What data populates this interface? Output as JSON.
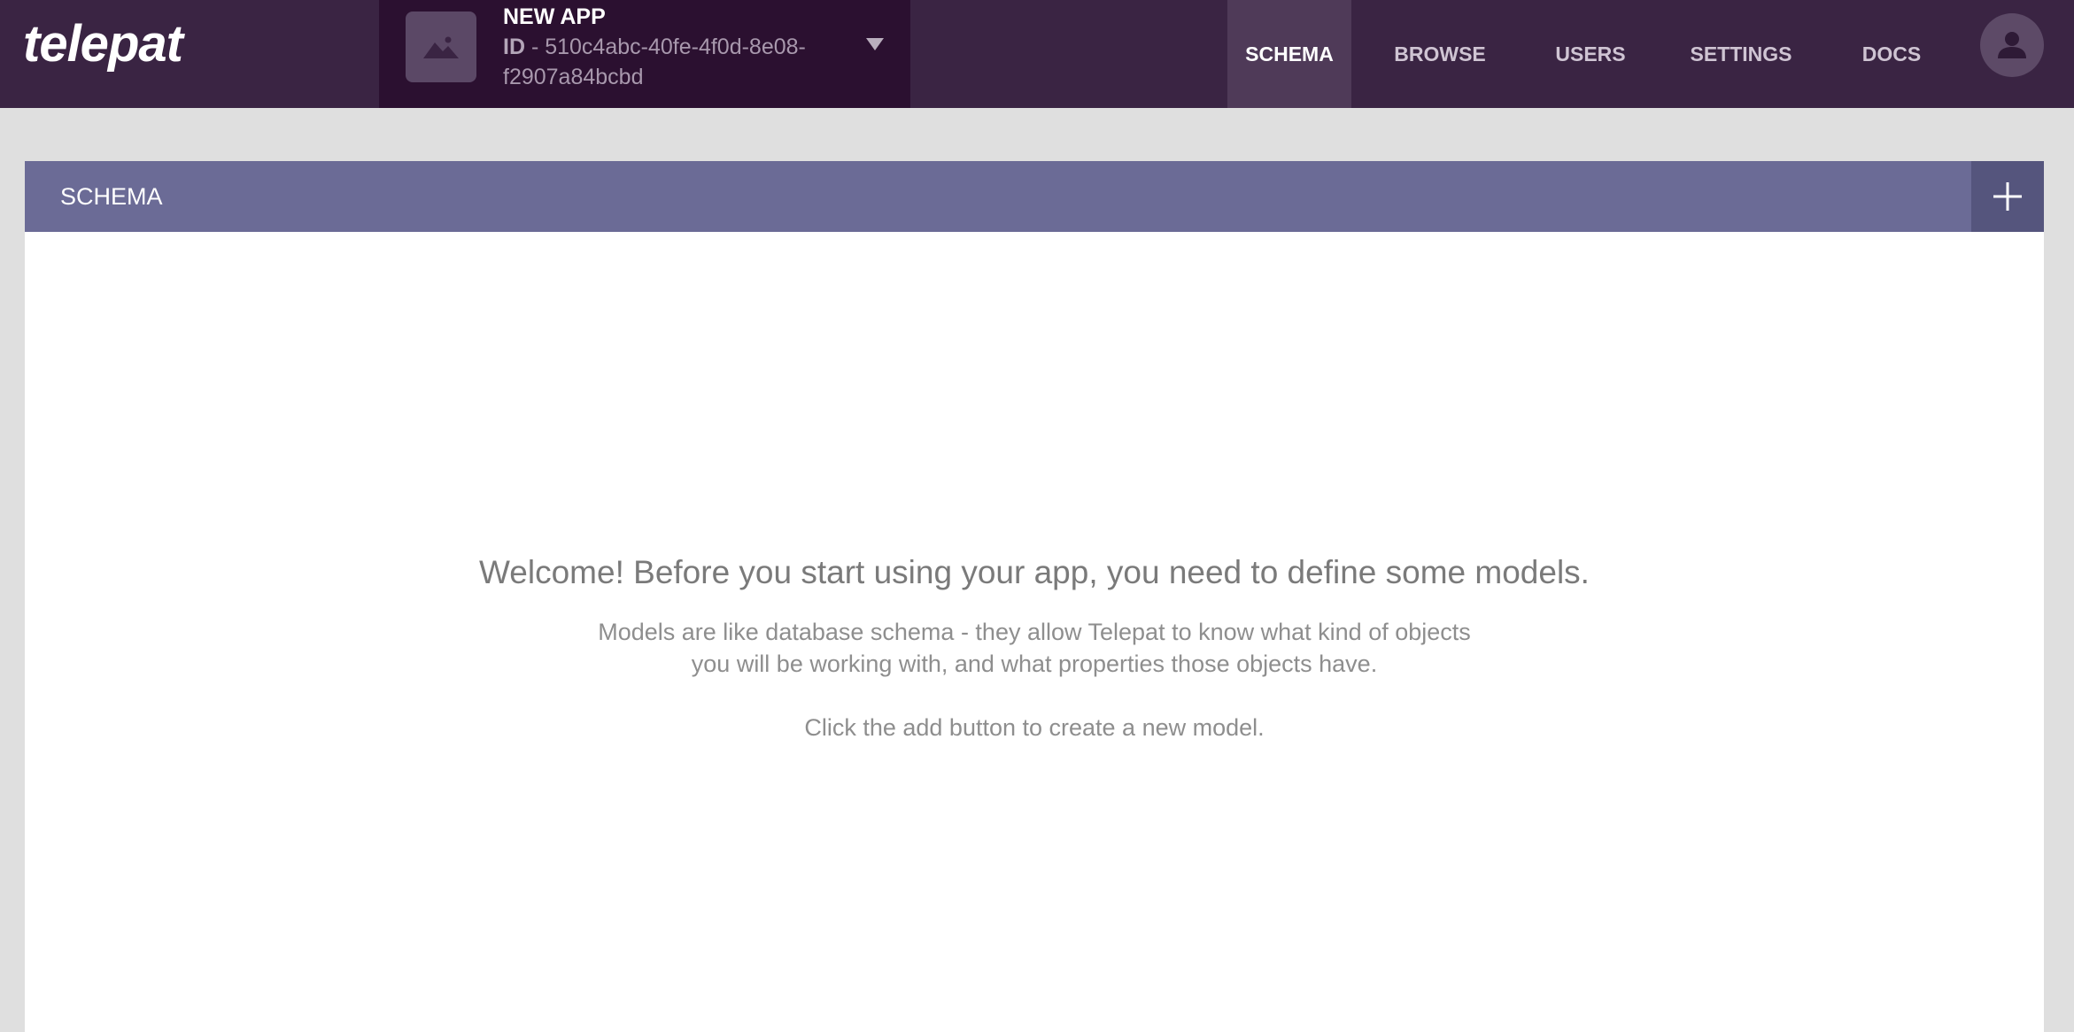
{
  "brand": {
    "logo_text": "telepat"
  },
  "app": {
    "name": "NEW APP",
    "id_label": "ID",
    "id_separator": " - ",
    "id_value": "510c4abc-40fe-4f0d-8e08-f2907a84bcbd",
    "thumbnail_icon": "image-icon",
    "dropdown_icon": "caret-down-icon"
  },
  "nav": {
    "items": [
      {
        "label": "SCHEMA",
        "active": true
      },
      {
        "label": "BROWSE",
        "active": false
      },
      {
        "label": "USERS",
        "active": false
      },
      {
        "label": "SETTINGS",
        "active": false
      },
      {
        "label": "DOCS",
        "active": false
      }
    ],
    "avatar_icon": "user-icon"
  },
  "schema": {
    "title": "SCHEMA",
    "add_icon": "plus-icon",
    "empty": {
      "heading": "Welcome! Before you start using your app, you need to define some models.",
      "description_line1": "Models are like database schema - they allow Telepat to know what kind of objects",
      "description_line2": "you will be working with, and what properties those objects have.",
      "hint": "Click the add button to create a new model."
    }
  },
  "colors": {
    "topbar": "#3a2443",
    "app_switcher": "#2b1030",
    "nav_active": "#4f3a58",
    "card_header": "#6b6b96",
    "add_button": "#55557d",
    "page_background": "#dfdfdf"
  }
}
